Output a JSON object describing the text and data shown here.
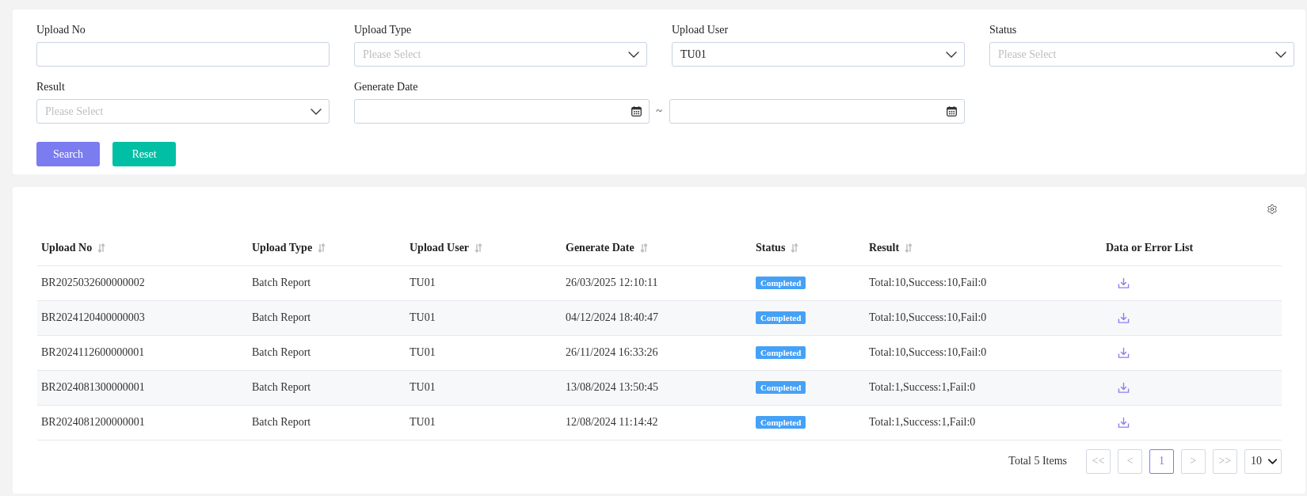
{
  "filters": [
    {
      "kind": "text",
      "label": "Upload No"
    },
    {
      "kind": "select",
      "label": "Upload Type",
      "placeholder": "Please Select"
    },
    {
      "kind": "select",
      "label": "Upload User",
      "value": "TU01"
    },
    {
      "kind": "select",
      "label": "Status",
      "placeholder": "Please Select"
    },
    {
      "kind": "select",
      "label": "Result",
      "placeholder": "Please Select"
    },
    {
      "kind": "date_range",
      "label": "Generate Date",
      "separator": "~"
    }
  ],
  "buttons": [
    {
      "kind": "primary",
      "label": "Search"
    },
    {
      "kind": "secondary",
      "label": "Reset"
    }
  ],
  "table": {
    "columns": [
      {
        "label": "Upload No",
        "sortable": true,
        "kind": "text"
      },
      {
        "label": "Upload Type",
        "sortable": true,
        "kind": "text"
      },
      {
        "label": "Upload User",
        "sortable": true,
        "kind": "text"
      },
      {
        "label": "Generate Date",
        "sortable": true,
        "kind": "text"
      },
      {
        "label": "Status",
        "sortable": true,
        "kind": "badge"
      },
      {
        "label": "Result",
        "sortable": true,
        "kind": "text"
      },
      {
        "label": "Data or Error List",
        "sortable": false,
        "kind": "download"
      }
    ],
    "rows": [
      {
        "cells": [
          "BR2025032600000002",
          "Batch Report",
          "TU01",
          "26/03/2025 12:10:11",
          "Completed",
          "Total:10,Success:10,Fail:0"
        ]
      },
      {
        "cells": [
          "BR2024120400000003",
          "Batch Report",
          "TU01",
          "04/12/2024 18:40:47",
          "Completed",
          "Total:10,Success:10,Fail:0"
        ]
      },
      {
        "cells": [
          "BR2024112600000001",
          "Batch Report",
          "TU01",
          "26/11/2024 16:33:26",
          "Completed",
          "Total:10,Success:10,Fail:0"
        ]
      },
      {
        "cells": [
          "BR2024081300000001",
          "Batch Report",
          "TU01",
          "13/08/2024 13:50:45",
          "Completed",
          "Total:1,Success:1,Fail:0"
        ]
      },
      {
        "cells": [
          "BR2024081200000001",
          "Batch Report",
          "TU01",
          "12/08/2024 11:14:42",
          "Completed",
          "Total:1,Success:1,Fail:0"
        ]
      }
    ]
  },
  "pagination": {
    "total": "Total 5 Items",
    "first": "<<",
    "prev": "<",
    "pages": [
      {
        "label": "1",
        "selected": true
      }
    ],
    "next": ">",
    "last": ">>",
    "page_size": "10"
  }
}
